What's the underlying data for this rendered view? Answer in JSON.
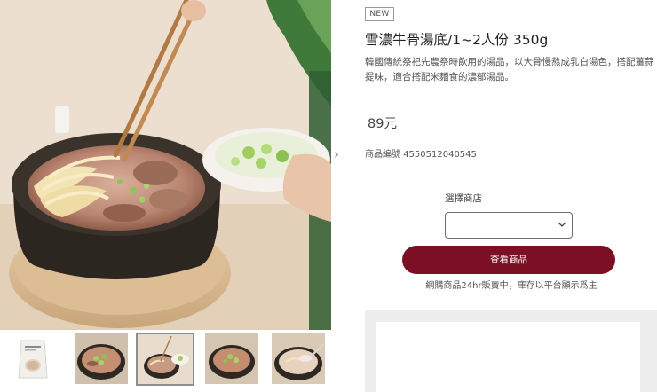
{
  "product": {
    "badge": "NEW",
    "title": "雪濃牛骨湯底/1~2人份 350g",
    "description": "韓國傳統祭祀先農祭時飲用的湯品，以大骨慢熬成乳白湯色，搭配薑蒜提味，適合搭配米麵食的濃郁湯品。",
    "price": "89元",
    "code_label": "商品編號",
    "code_value": "4550512040545"
  },
  "store": {
    "label": "選擇商店",
    "selected_value": ""
  },
  "actions": {
    "view_product": "查看商品"
  },
  "note": "網購商品24hr販賣中，庫存以平台顯示爲主",
  "gallery": {
    "next_icon": "chevron-right-icon",
    "thumbnails": [
      {
        "subject": "package",
        "active": false
      },
      {
        "subject": "soup-bowl-meat",
        "active": false
      },
      {
        "subject": "soup-with-noodles",
        "active": true
      },
      {
        "subject": "soup-bowl-green-onion",
        "active": false
      },
      {
        "subject": "soup-with-spoon",
        "active": false
      }
    ]
  },
  "colors": {
    "primary_button": "#7b0f24",
    "panel_bg": "#ededed"
  }
}
